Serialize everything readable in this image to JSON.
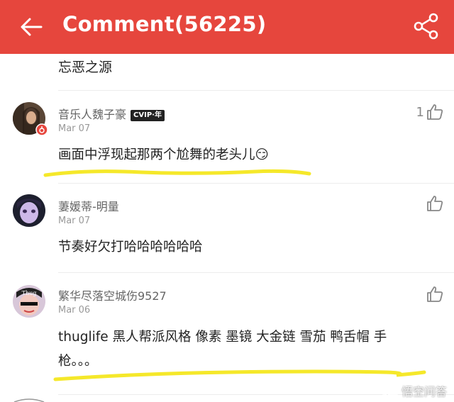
{
  "header": {
    "title": "Comment(56225)",
    "back_icon": "back-arrow-icon",
    "share_icon": "share-icon",
    "bg_color": "#e6463d"
  },
  "top_snippet": "忘恶之源",
  "comments": [
    {
      "username": "音乐人魏子豪",
      "badge": "CVIP·年",
      "date": "Mar 07",
      "text": "画面中浮现起那两个尬舞的老头儿😏",
      "likes": "1"
    },
    {
      "username": "萋媛蒂-明量",
      "date": "Mar 07",
      "text": "节奏好欠打哈哈哈哈哈哈",
      "likes": ""
    },
    {
      "username": "繁华尽落空城伤9527",
      "date": "Mar 06",
      "text_line1": "thuglife  黑人帮派风格  像素  墨镜  大金链  雪茄  鸭舌帽  手",
      "text_line2": "枪。。。",
      "likes": ""
    }
  ],
  "watermark": "悟空问答",
  "highlight_color": "#f5e82a"
}
